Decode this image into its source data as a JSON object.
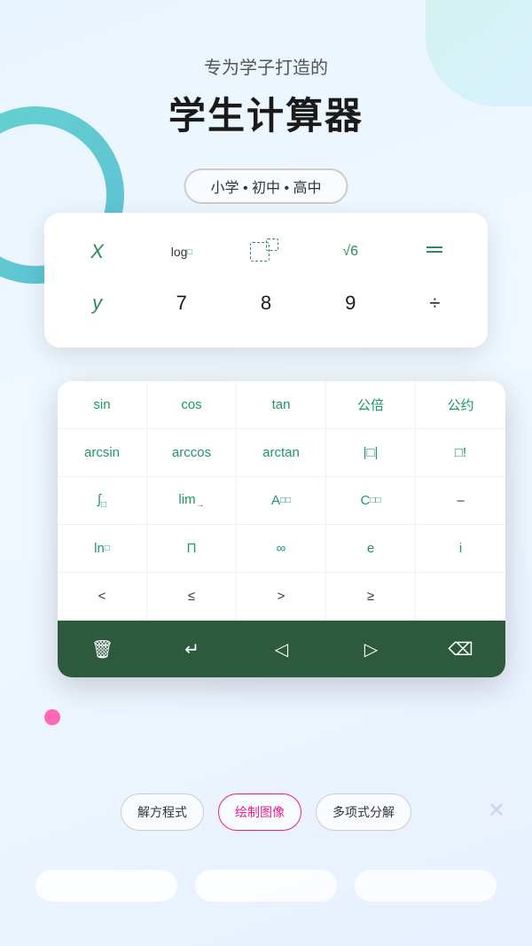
{
  "app": {
    "subtitle": "专为学子打造的",
    "title": "学生计算器",
    "levels": {
      "label": "小学  •  初中  •  高中"
    }
  },
  "calc_back": {
    "row1": [
      "X",
      "log□",
      "□",
      "√6",
      "÷̄"
    ],
    "row2": [
      "y",
      "7",
      "8",
      "9",
      "÷"
    ]
  },
  "func_grid": [
    [
      "sin",
      "cos",
      "tan",
      "公倍",
      "公约"
    ],
    [
      "arcsin",
      "arccos",
      "arctan",
      "|□|",
      "□!"
    ],
    [
      "∫□",
      "lim□",
      "A□",
      "C□",
      "–"
    ],
    [
      "ln□",
      "Π",
      "∞",
      "e",
      "i"
    ],
    [
      "<",
      "<",
      ">",
      ">",
      ""
    ]
  ],
  "toolbar": {
    "delete": "🗑",
    "enter": "↵",
    "left": "◁",
    "right": "▷",
    "backspace": "⌫"
  },
  "features": [
    {
      "label": "解方程式",
      "style": "normal"
    },
    {
      "label": "绘制图像",
      "style": "active"
    },
    {
      "label": "多项式分解",
      "style": "normal"
    }
  ]
}
